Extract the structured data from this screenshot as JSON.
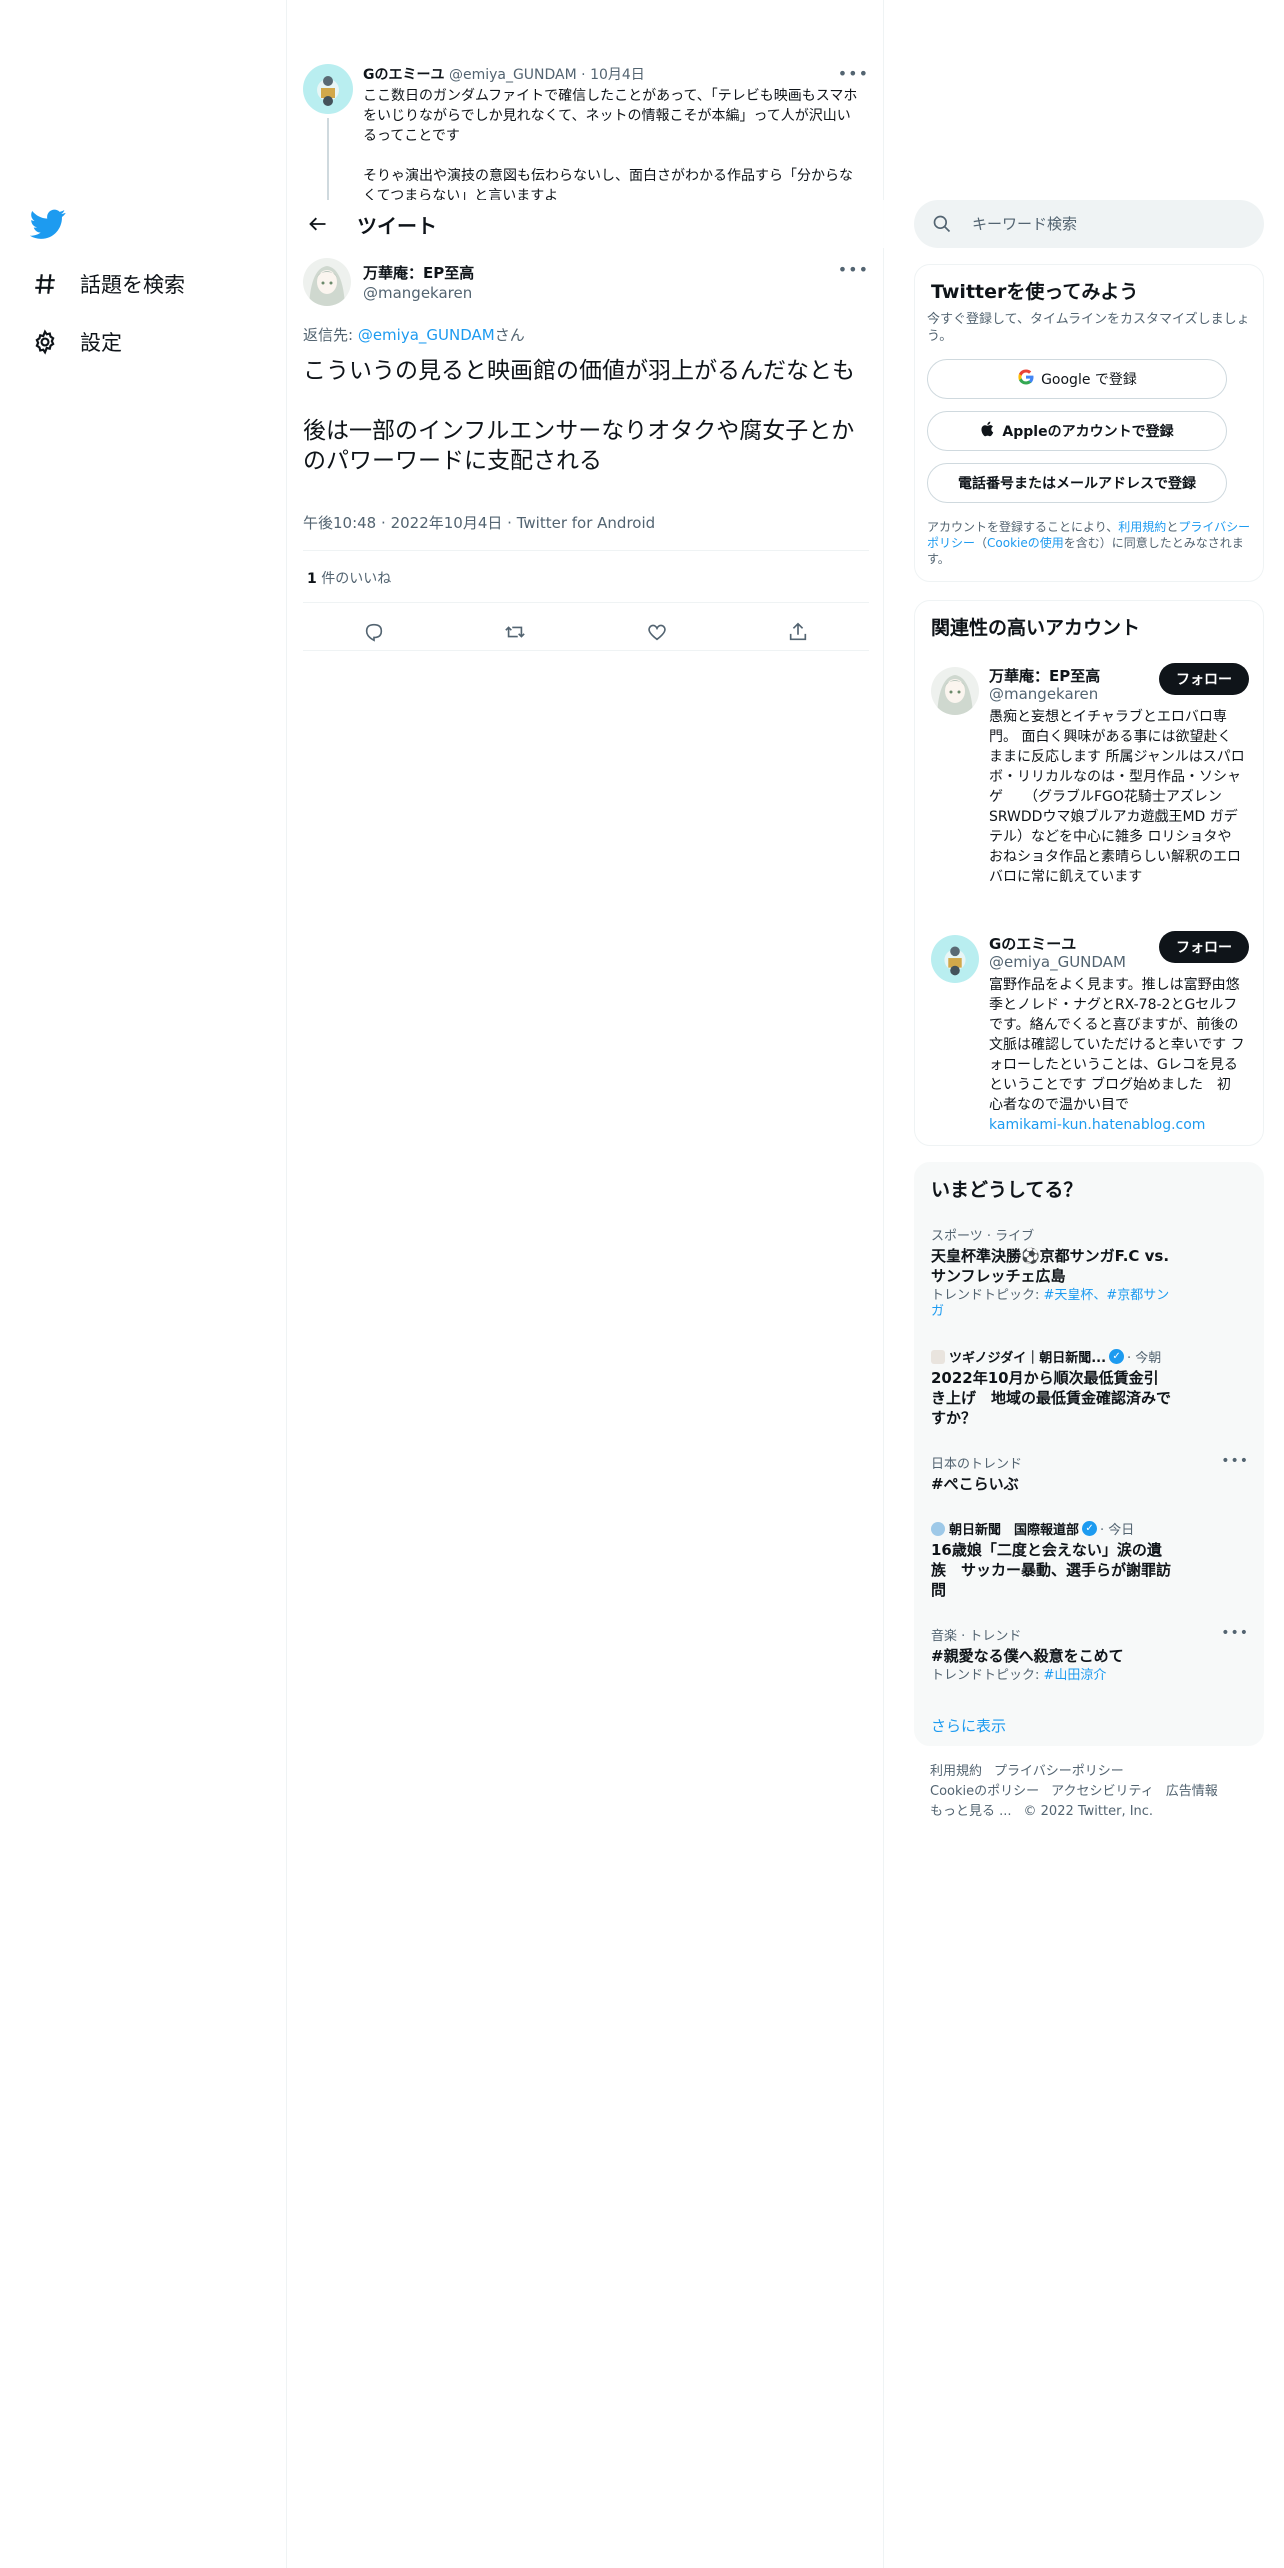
{
  "nav": {
    "items": [
      {
        "label": "話題を検索"
      },
      {
        "label": "設定"
      }
    ]
  },
  "parent_tweet": {
    "name": "Gのエミーユ",
    "handle": "@emiya_GUNDAM",
    "sep": "·",
    "date": "10月4日",
    "lines": [
      "ここ数日のガンダムファイトで確信したことがあって、「テレビも映画もスマホをいじりながらでしか見れなくて、ネットの情報こそが本編」って人が沢山いるってことです",
      "そりゃ演出や演技の意図も伝わらないし、面白さがわかる作品すら「分からなくてつまらない」と言いますよ"
    ]
  },
  "header": {
    "title": "ツイート"
  },
  "tweet": {
    "name": "万華庵：EP至高",
    "handle": "@mangekaren",
    "reply_prefix": "返信先: ",
    "reply_to": "@emiya_GUNDAM",
    "reply_suffix": "さん",
    "text": [
      "こういうの見ると映画館の価値が羽上がるんだなとも",
      "後は一部のインフルエンサーなりオタクや腐女子とかのパワーワードに支配される"
    ],
    "time": "午後10:48",
    "sep1": "·",
    "date": "2022年10月4日",
    "sep2": "·",
    "source": "Twitter for Android",
    "likes_count": "1",
    "likes_label": " 件のいいね"
  },
  "search": {
    "placeholder": "キーワード検索"
  },
  "signup": {
    "title": "Twitterを使ってみよう",
    "desc": "今すぐ登録して、タイムラインをカスタマイズしましょう。",
    "google": "Google で登録",
    "apple": "Appleのアカウントで登録",
    "phone": "電話番号またはメールアドレスで登録",
    "legal_1": "アカウントを登録することにより、",
    "legal_terms": "利用規約",
    "legal_2": "と",
    "legal_privacy": "プライバシーポリシー",
    "legal_3": "（",
    "legal_cookie": "Cookieの使用",
    "legal_4": "を含む）に同意したとみなされます。"
  },
  "reco": {
    "title": "関連性の高いアカウント",
    "follow": "フォロー",
    "accounts": [
      {
        "name": "万華庵：EP至高",
        "handle": "@mangekaren",
        "bio": "愚痴と妄想とイチャラブとエロバロ専門。 面白く興味がある事には欲望赴くままに反応します 所属ジャンルはスパロボ・リリカルなのは・型月作品・ソシャゲ　　（グラブルFGO花騎士アズレンSRWDDウマ娘ブルアカ遊戯王MD ガデテル）などを中心に雑多 ロリショタやおねショタ作品と素晴らしい解釈のエロバロに常に飢えています"
      },
      {
        "name": "Gのエミーユ",
        "handle": "@emiya_GUNDAM",
        "bio": "富野作品をよく見ます。推しは富野由悠季とノレド・ナグとRX-78-2とGセルフです。絡んでくると喜びますが、前後の文脈は確認していただけると幸いです フォローしたということは、Gレコを見るということです ブログ始めました　初心者なので温かい目で",
        "link": "kamikami-kun.hatenablog.com"
      }
    ]
  },
  "trends": {
    "title": "いまどうしてる？",
    "items": [
      {
        "context": "スポーツ · ライブ",
        "title": "天皇杯準決勝⚽京都サンガF.C vs. サンフレッチェ広島",
        "sub_prefix": "トレンドトピック: ",
        "sub_tags": "#天皇杯、#京都サンガ"
      },
      {
        "source": "ツギノジダイ｜朝日新聞...",
        "time": "· 今朝",
        "title": "2022年10月から順次最低賃金引き上げ　地域の最低賃金確認済みですか？"
      },
      {
        "context": "日本のトレンド",
        "title": "#ぺこらいぶ"
      },
      {
        "source": "朝日新聞　国際報道部",
        "time": "· 今日",
        "title": "16歳娘「二度と会えない」涙の遺族　サッカー暴動、選手らが謝罪訪問"
      },
      {
        "context": "音楽 · トレンド",
        "title": "#親愛なる僕へ殺意をこめて",
        "sub_prefix": "トレンドトピック: ",
        "sub_tags": "#山田涼介"
      }
    ],
    "show_more": "さらに表示"
  },
  "footer": {
    "links": [
      "利用規約",
      "プライバシーポリシー",
      "Cookieのポリシー",
      "アクセシビリティ",
      "広告情報",
      "もっと見る ..."
    ],
    "copyright": "© 2022 Twitter, Inc."
  },
  "colors": {
    "accent": "#1d9bf0",
    "text": "#0f1419",
    "muted": "#536471",
    "border": "#eff3f4"
  },
  "icons": [
    "twitter-bird-icon",
    "hashtag-icon",
    "gear-icon",
    "back-arrow-icon",
    "reply-icon",
    "retweet-icon",
    "like-icon",
    "share-icon",
    "search-icon",
    "google-icon",
    "apple-icon",
    "verified-icon",
    "more-icon"
  ]
}
